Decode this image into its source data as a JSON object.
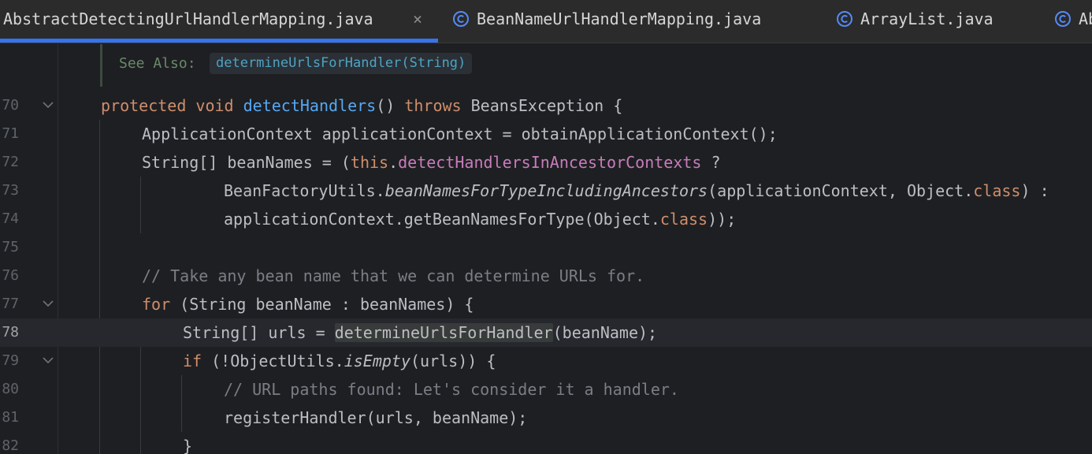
{
  "tabs": [
    {
      "label": "AbstractDetectingUrlHandlerMapping.java",
      "active": true,
      "close_glyph": "×"
    },
    {
      "label": "BeanNameUrlHandlerMapping.java",
      "icon": "class-icon"
    },
    {
      "label": "ArrayList.java",
      "icon": "class-icon"
    },
    {
      "label": "Ab",
      "icon": "class-icon"
    }
  ],
  "doc": {
    "see_also_label": "See Also:",
    "link_text": "determineUrlsForHandler(String)"
  },
  "colors": {
    "background": "#1e1f22",
    "keyword": "#cf8e6d",
    "function": "#56a8f5",
    "field": "#c77dbb",
    "comment": "#7a7e85",
    "accent": "#3574f0"
  },
  "lines": [
    {
      "number": "70",
      "foldable": true,
      "tokens": [
        {
          "t": "protected",
          "c": "kw"
        },
        {
          "t": " "
        },
        {
          "t": "void",
          "c": "kw"
        },
        {
          "t": " "
        },
        {
          "t": "detectHandlers",
          "c": "fn"
        },
        {
          "t": "() "
        },
        {
          "t": "throws",
          "c": "kw"
        },
        {
          "t": " BeansException {"
        }
      ]
    },
    {
      "number": "71",
      "tokens": [
        {
          "t": "ApplicationContext applicationContext = obtainApplicationContext();"
        }
      ]
    },
    {
      "number": "72",
      "tokens": [
        {
          "t": "String[] beanNames = ("
        },
        {
          "t": "this",
          "c": "kw"
        },
        {
          "t": "."
        },
        {
          "t": "detectHandlersInAncestorContexts",
          "c": "field"
        },
        {
          "t": " ?"
        }
      ]
    },
    {
      "number": "73",
      "tokens": [
        {
          "t": "BeanFactoryUtils."
        },
        {
          "t": "beanNamesForTypeIncludingAncestors",
          "c": "italic"
        },
        {
          "t": "(applicationContext, Object."
        },
        {
          "t": "class",
          "c": "kw"
        },
        {
          "t": ") :"
        }
      ]
    },
    {
      "number": "74",
      "tokens": [
        {
          "t": "applicationContext.getBeanNamesForType(Object."
        },
        {
          "t": "class",
          "c": "kw"
        },
        {
          "t": "));"
        }
      ]
    },
    {
      "number": "75",
      "tokens": []
    },
    {
      "number": "76",
      "tokens": [
        {
          "t": "// Take any bean name that we can determine URLs for.",
          "c": "comment"
        }
      ]
    },
    {
      "number": "77",
      "foldable": true,
      "tokens": [
        {
          "t": "for",
          "c": "kw"
        },
        {
          "t": " (String beanName : beanNames) {"
        }
      ]
    },
    {
      "number": "78",
      "current": true,
      "tokens": [
        {
          "t": "String[] urls = "
        },
        {
          "t": "determineUrlsForHandler",
          "c": "hl"
        },
        {
          "t": "(beanName);"
        }
      ]
    },
    {
      "number": "79",
      "foldable": true,
      "tokens": [
        {
          "t": "if",
          "c": "kw"
        },
        {
          "t": " (!ObjectUtils."
        },
        {
          "t": "isEmpty",
          "c": "italic"
        },
        {
          "t": "(urls)) {"
        }
      ]
    },
    {
      "number": "80",
      "tokens": [
        {
          "t": "// URL paths found: Let's consider it a handler.",
          "c": "comment"
        }
      ]
    },
    {
      "number": "81",
      "tokens": [
        {
          "t": "registerHandler(urls, beanName);"
        }
      ]
    },
    {
      "number": "82",
      "tokens": [
        {
          "t": "}"
        }
      ]
    }
  ]
}
